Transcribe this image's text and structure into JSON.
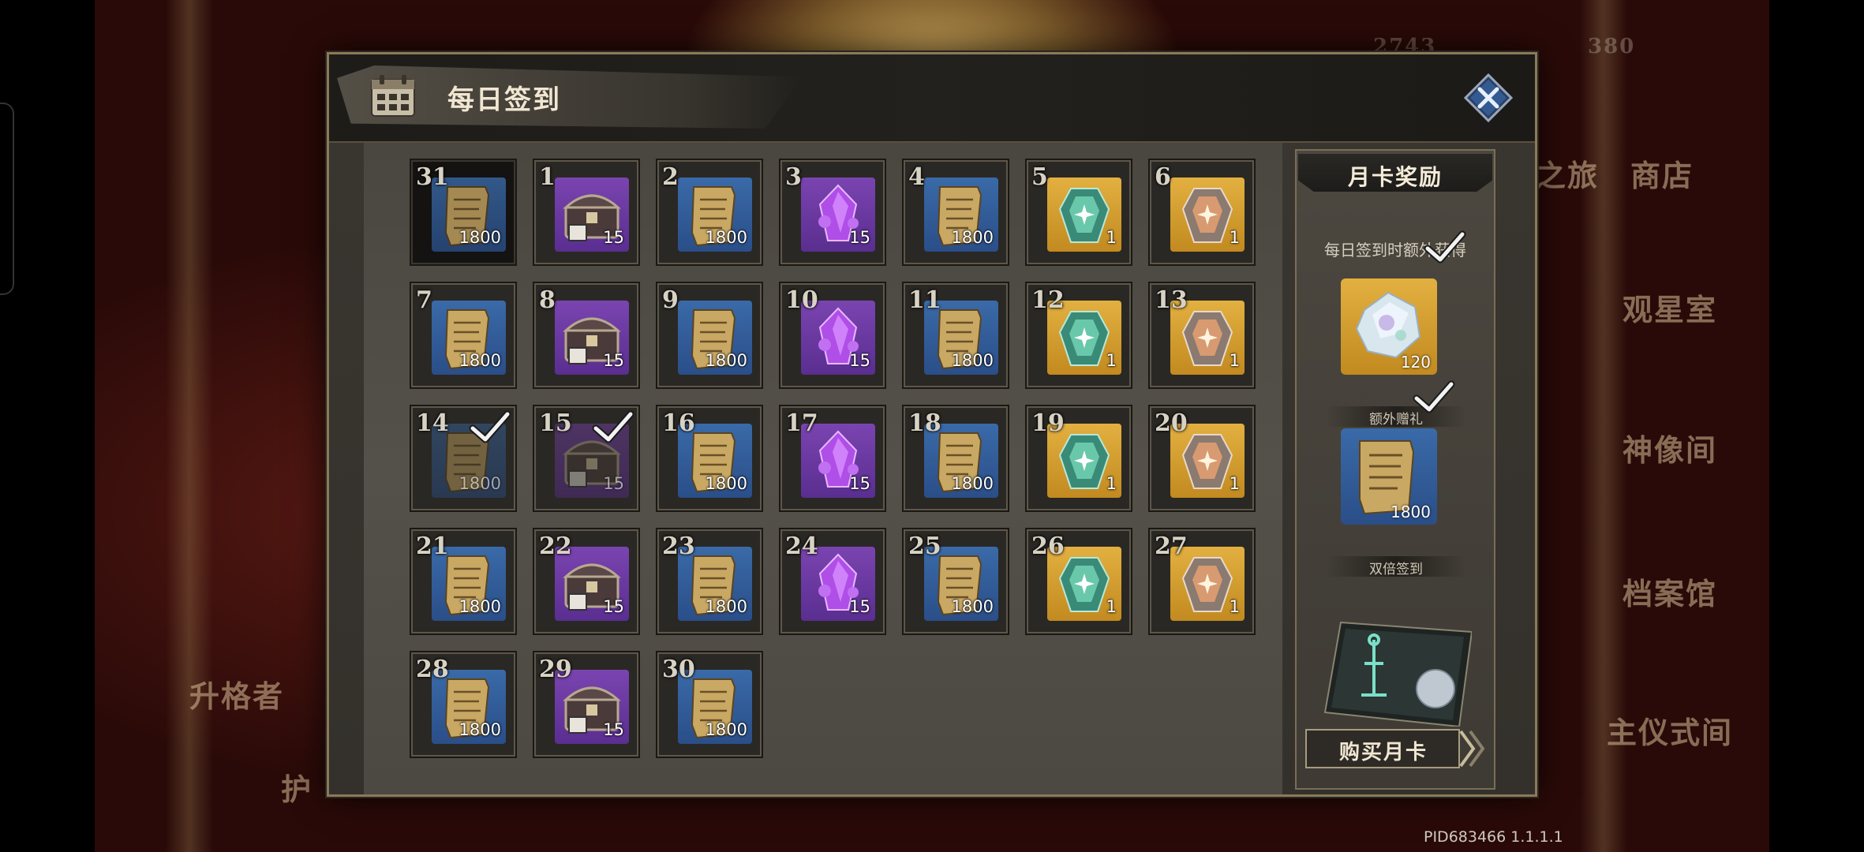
{
  "background": {
    "labels": [
      "商店",
      "观星室",
      "神像间",
      "档案馆",
      "主仪式间",
      "升格者",
      "之旅",
      "护"
    ],
    "counter_left": "2743",
    "counter_right": "380",
    "pid": "PID683466  1.1.1.1"
  },
  "modal": {
    "title": "每日签到",
    "close_icon": "close-x-icon"
  },
  "days": [
    {
      "day": "31",
      "reward": "scroll",
      "qty": "1800",
      "color": "blue",
      "state": "today"
    },
    {
      "day": "1",
      "reward": "chest",
      "qty": "15",
      "color": "purple",
      "state": "normal"
    },
    {
      "day": "2",
      "reward": "scroll",
      "qty": "1800",
      "color": "blue",
      "state": "normal"
    },
    {
      "day": "3",
      "reward": "crystal",
      "qty": "15",
      "color": "purple",
      "state": "normal"
    },
    {
      "day": "4",
      "reward": "scroll",
      "qty": "1800",
      "color": "blue",
      "state": "normal"
    },
    {
      "day": "5",
      "reward": "green-gem",
      "qty": "1",
      "color": "gold",
      "state": "normal"
    },
    {
      "day": "6",
      "reward": "orange-gem",
      "qty": "1",
      "color": "gold",
      "state": "normal"
    },
    {
      "day": "7",
      "reward": "scroll",
      "qty": "1800",
      "color": "blue",
      "state": "normal"
    },
    {
      "day": "8",
      "reward": "chest",
      "qty": "15",
      "color": "purple",
      "state": "normal"
    },
    {
      "day": "9",
      "reward": "scroll",
      "qty": "1800",
      "color": "blue",
      "state": "normal"
    },
    {
      "day": "10",
      "reward": "crystal",
      "qty": "15",
      "color": "purple",
      "state": "normal"
    },
    {
      "day": "11",
      "reward": "scroll",
      "qty": "1800",
      "color": "blue",
      "state": "normal"
    },
    {
      "day": "12",
      "reward": "green-gem",
      "qty": "1",
      "color": "gold",
      "state": "normal"
    },
    {
      "day": "13",
      "reward": "orange-gem",
      "qty": "1",
      "color": "gold",
      "state": "normal"
    },
    {
      "day": "14",
      "reward": "scroll",
      "qty": "1800",
      "color": "blue",
      "state": "claimed"
    },
    {
      "day": "15",
      "reward": "chest",
      "qty": "15",
      "color": "purple",
      "state": "claimed"
    },
    {
      "day": "16",
      "reward": "scroll",
      "qty": "1800",
      "color": "blue",
      "state": "normal"
    },
    {
      "day": "17",
      "reward": "crystal",
      "qty": "15",
      "color": "purple",
      "state": "normal"
    },
    {
      "day": "18",
      "reward": "scroll",
      "qty": "1800",
      "color": "blue",
      "state": "normal"
    },
    {
      "day": "19",
      "reward": "green-gem",
      "qty": "1",
      "color": "gold",
      "state": "normal"
    },
    {
      "day": "20",
      "reward": "orange-gem",
      "qty": "1",
      "color": "gold",
      "state": "normal"
    },
    {
      "day": "21",
      "reward": "scroll",
      "qty": "1800",
      "color": "blue",
      "state": "normal"
    },
    {
      "day": "22",
      "reward": "chest",
      "qty": "15",
      "color": "purple",
      "state": "normal"
    },
    {
      "day": "23",
      "reward": "scroll",
      "qty": "1800",
      "color": "blue",
      "state": "normal"
    },
    {
      "day": "24",
      "reward": "crystal",
      "qty": "15",
      "color": "purple",
      "state": "normal"
    },
    {
      "day": "25",
      "reward": "scroll",
      "qty": "1800",
      "color": "blue",
      "state": "normal"
    },
    {
      "day": "26",
      "reward": "green-gem",
      "qty": "1",
      "color": "gold",
      "state": "normal"
    },
    {
      "day": "27",
      "reward": "orange-gem",
      "qty": "1",
      "color": "gold",
      "state": "normal"
    },
    {
      "day": "28",
      "reward": "scroll",
      "qty": "1800",
      "color": "blue",
      "state": "normal"
    },
    {
      "day": "29",
      "reward": "chest",
      "qty": "15",
      "color": "purple",
      "state": "normal"
    },
    {
      "day": "30",
      "reward": "scroll",
      "qty": "1800",
      "color": "blue",
      "state": "normal"
    }
  ],
  "side_panel": {
    "title": "月卡奖励",
    "subtitle": "每日签到时额外获得",
    "bonus_qty": "120",
    "bonus_label": "额外赠礼",
    "double_qty": "1800",
    "double_label": "双倍签到",
    "buy_label": "购买月卡"
  },
  "colors": {
    "blue_tile": "#3a6aa8",
    "purple_tile": "#7a44b0",
    "gold_tile": "#e2b040",
    "frame": "#8a7a58"
  }
}
